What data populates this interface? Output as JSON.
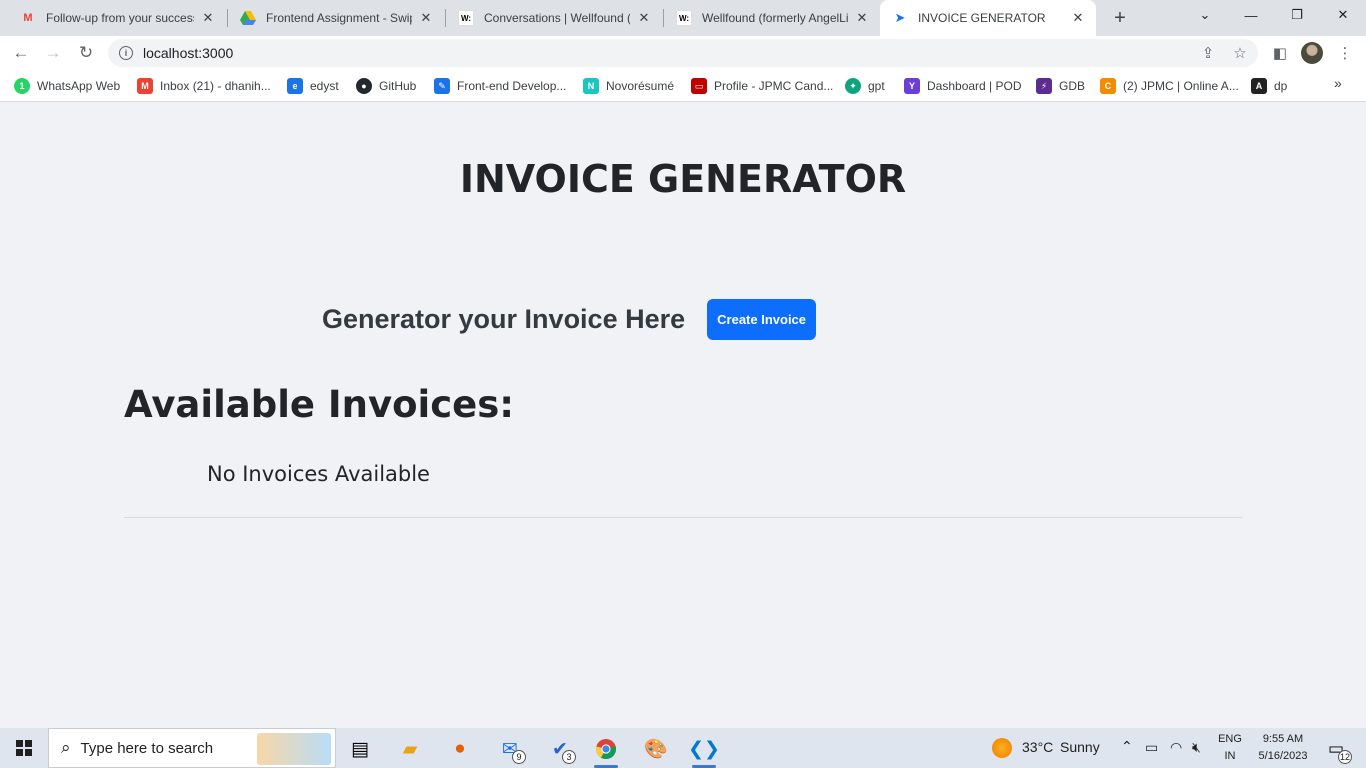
{
  "browser": {
    "tabs": [
      {
        "title": "Follow-up from your success",
        "icon": "gmail-icon",
        "active": false
      },
      {
        "title": "Frontend Assignment - Swipe",
        "icon": "google-drive-icon",
        "active": false
      },
      {
        "title": "Conversations | Wellfound (fo",
        "icon": "wellfound-icon",
        "active": false
      },
      {
        "title": "Wellfound (formerly AngelLis",
        "icon": "wellfound-icon",
        "active": false
      },
      {
        "title": "INVOICE GENERATOR",
        "icon": "paper-plane-icon",
        "active": true
      }
    ],
    "url": "localhost:3000",
    "bookmarks": [
      {
        "label": "WhatsApp Web",
        "color": "#25d366",
        "glyph": "1"
      },
      {
        "label": "Inbox (21) - dhanih...",
        "color": "#ea4335",
        "glyph": "M"
      },
      {
        "label": "edyst",
        "color": "#1a73e8",
        "glyph": "e"
      },
      {
        "label": "GitHub",
        "color": "#24292f",
        "glyph": "●"
      },
      {
        "label": "Front-end Develop...",
        "color": "#1a73e8",
        "glyph": "✎"
      },
      {
        "label": "Novorésumé",
        "color": "#1cc5c0",
        "glyph": "N"
      },
      {
        "label": "Profile - JPMC Cand...",
        "color": "#c00000",
        "glyph": "▭"
      },
      {
        "label": "gpt",
        "color": "#10a37f",
        "glyph": "✦"
      },
      {
        "label": "Dashboard | POD",
        "color": "#6a3fd6",
        "glyph": "Y"
      },
      {
        "label": "GDB",
        "color": "#5c2d91",
        "glyph": "⚡"
      },
      {
        "label": "(2) JPMC | Online A...",
        "color": "#f28b00",
        "glyph": "C"
      },
      {
        "label": "dp",
        "color": "#222222",
        "glyph": "A"
      }
    ]
  },
  "app": {
    "title": "INVOICE GENERATOR",
    "generator_text": "Generator your Invoice Here",
    "create_button": "Create Invoice",
    "available_heading": "Available Invoices:",
    "empty_message": "No Invoices Available",
    "accent_color": "#0d6efd"
  },
  "taskbar": {
    "search_placeholder": "Type here to search",
    "mail_badge": "9",
    "todo_badge": "3",
    "weather_temp": "33°C",
    "weather_text": "Sunny",
    "lang_top": "ENG",
    "lang_bottom": "IN",
    "time": "9:55 AM",
    "date": "5/16/2023",
    "notif_count": "12"
  }
}
